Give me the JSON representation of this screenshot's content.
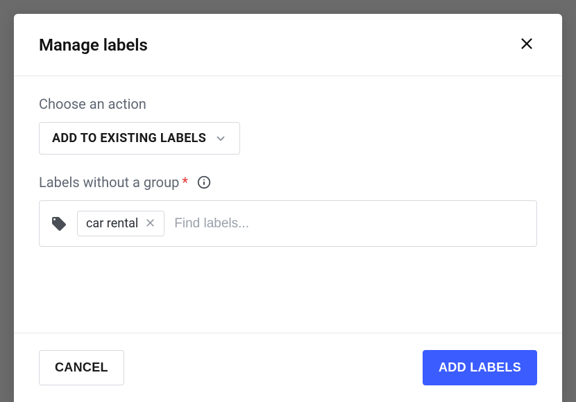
{
  "modal": {
    "title": "Manage labels",
    "action_label": "Choose an action",
    "dropdown_value": "ADD TO EXISTING LABELS",
    "labels_section_label": "Labels without a group",
    "chips": [
      {
        "label": "car rental"
      }
    ],
    "find_placeholder": "Find labels...",
    "cancel_label": "CANCEL",
    "submit_label": "ADD LABELS"
  }
}
